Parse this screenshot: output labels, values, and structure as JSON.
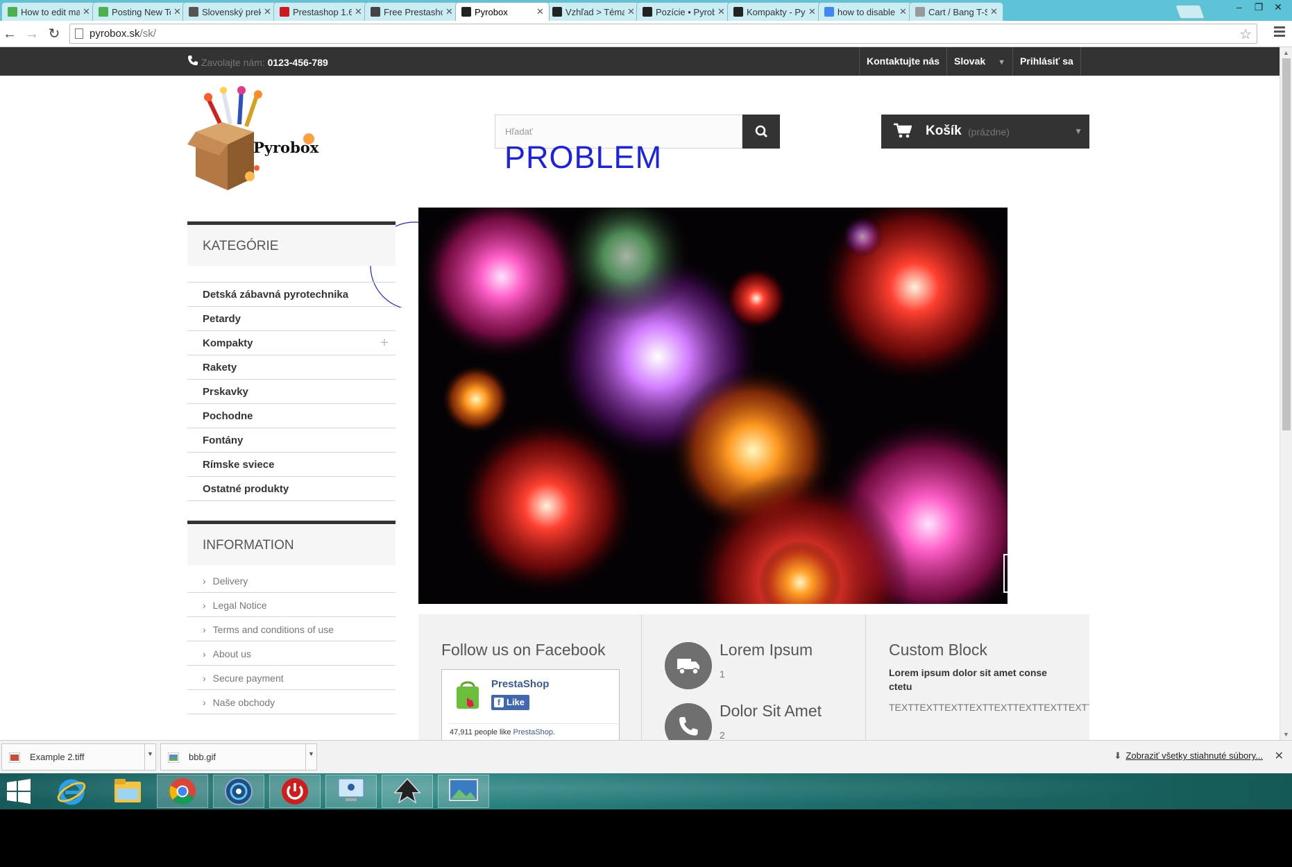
{
  "browser": {
    "tabs": [
      {
        "label": "How to edit ma",
        "favicon": "prestashop-forum-icon",
        "color": "#4caf50"
      },
      {
        "label": "Posting New To",
        "favicon": "prestashop-forum-icon",
        "color": "#4caf50"
      },
      {
        "label": "Slovenský prekl",
        "favicon": "translate-book-icon",
        "color": "#555555"
      },
      {
        "label": "Prestashop 1.6 t",
        "favicon": "youtube-icon",
        "color": "#cc181e"
      },
      {
        "label": "Free Prestashop",
        "favicon": "glasses-icon",
        "color": "#444444"
      },
      {
        "label": "Pyrobox",
        "favicon": "prestashop-icon",
        "color": "#222222",
        "active": true
      },
      {
        "label": "Vzhľad > Téma",
        "favicon": "prestashop-icon",
        "color": "#222222"
      },
      {
        "label": "Pozície • Pyrob",
        "favicon": "prestashop-icon",
        "color": "#222222"
      },
      {
        "label": "Kompakty - Pyr",
        "favicon": "prestashop-icon",
        "color": "#222222"
      },
      {
        "label": "how to disable",
        "favicon": "google-icon",
        "color": "#4285f4"
      },
      {
        "label": "Cart / Bang T-S",
        "favicon": "page-icon",
        "color": "#999999"
      }
    ],
    "url_host": "pyrobox.sk",
    "url_path": "/sk/"
  },
  "store": {
    "call_label": "Zavolajte nám:",
    "phone": "0123-456-789",
    "topnav": {
      "contact": "Kontaktujte nás",
      "language": "Slovak",
      "login": "Prihlásiť sa"
    },
    "logo_text": "Pyrobox",
    "search_placeholder": "Hľadať",
    "cart": {
      "title": "Košík",
      "status": "(prázdne)"
    },
    "categories_title": "KATEGÓRIE",
    "categories": [
      "Detská zábavná pyrotechnika",
      "Petardy",
      "Kompakty",
      "Rakety",
      "Prskavky",
      "Pochodne",
      "Fontány",
      "Rímske sviece",
      "Ostatné produkty"
    ],
    "information_title": "INFORMATION",
    "information": [
      "Delivery",
      "Legal Notice",
      "Terms and conditions of use",
      "About us",
      "Secure payment",
      "Naše obchody"
    ],
    "facebook": {
      "title": "Follow us on Facebook",
      "page_name": "PrestaShop",
      "like_label": "Like",
      "count_text": "47,911 people like",
      "count_link": "PrestaShop."
    },
    "reassurance": [
      {
        "title": "Lorem Ipsum",
        "num": "1",
        "icon": "truck-icon"
      },
      {
        "title": "Dolor Sit Amet",
        "num": "2",
        "icon": "phone-icon"
      }
    ],
    "custom_block": {
      "title": "Custom Block",
      "bold": "Lorem ipsum dolor sit amet conse ctetu",
      "text": "TEXTTEXTTEXTTEXTTEXTTEXTTEXTTEXTTEXT"
    }
  },
  "annotation": {
    "label": "PROBLEM",
    "color": "#1b22e6"
  },
  "downloads": {
    "items": [
      {
        "name": "Example 2.tiff",
        "icon": "tiff-file-icon"
      },
      {
        "name": "bbb.gif",
        "icon": "gif-file-icon"
      }
    ],
    "show_all": "Zobraziť všetky stiahnuté súbory..."
  },
  "taskbar": {
    "items": [
      "start-icon",
      "internet-explorer-icon",
      "file-explorer-icon",
      "chrome-icon",
      "disk-utility-icon",
      "power-icon",
      "remote-desktop-icon",
      "inkscape-icon",
      "photo-viewer-icon"
    ]
  }
}
